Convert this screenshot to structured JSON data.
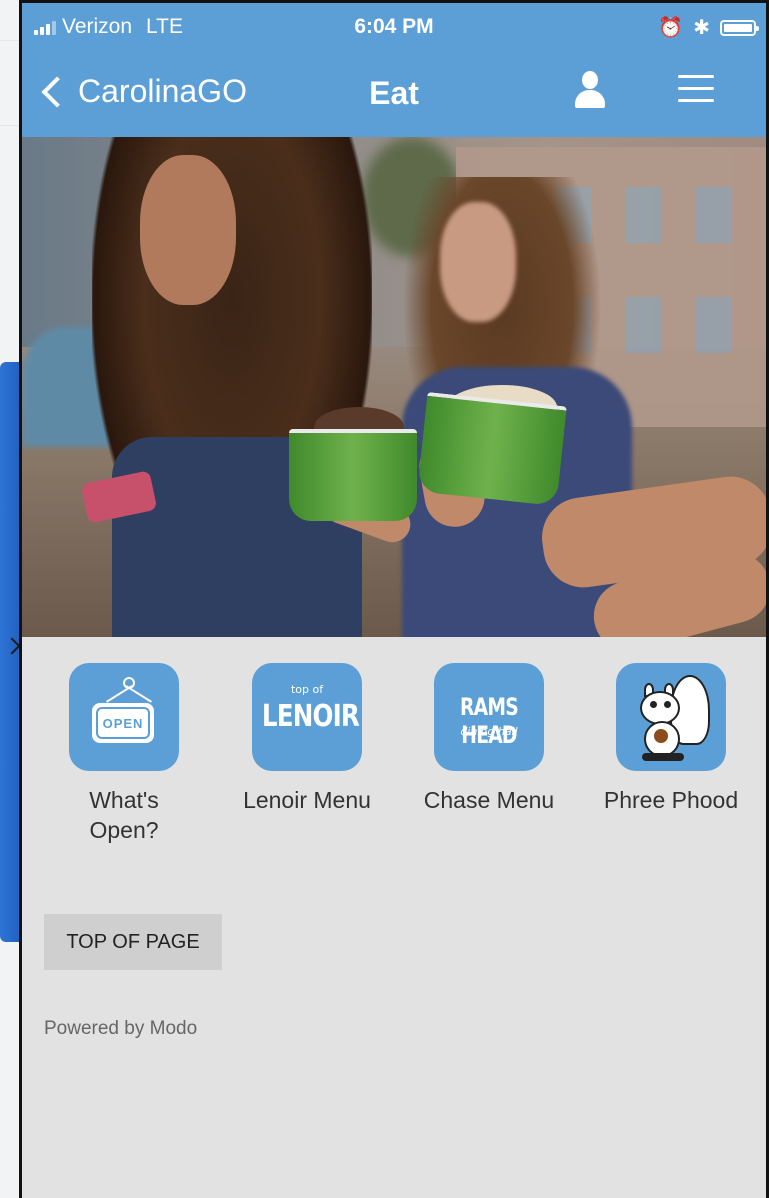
{
  "status_bar": {
    "carrier": "Verizon",
    "network": "LTE",
    "time": "6:04 PM",
    "icons": [
      "signal-icon",
      "alarm-icon",
      "bluetooth-icon",
      "battery-icon"
    ]
  },
  "nav": {
    "back_label": "CarolinaGO",
    "title": "Eat",
    "icons": [
      "chevron-left-icon",
      "user-icon",
      "menu-icon"
    ]
  },
  "hero": {
    "description_icon": "hero-photo"
  },
  "tiles": [
    {
      "label": "What's Open?",
      "icon": "open-sign-icon"
    },
    {
      "label": "Lenoir Menu",
      "icon": "lenoir-logo-icon",
      "logo_top": "top of",
      "logo_main": "LENOIR"
    },
    {
      "label": "Chase Menu",
      "icon": "rams-head-logo-icon",
      "logo_main": "RAMS HEAD",
      "logo_sub": "dining hall"
    },
    {
      "label": "Phree Phood",
      "icon": "squirrel-icon"
    }
  ],
  "open_sign_text": "OPEN",
  "footer": {
    "top_button": "TOP OF PAGE",
    "powered_by": "Powered by Modo"
  },
  "colors": {
    "nav_blue": "#5b9fd6",
    "page_gray": "#e2e2e2",
    "button_gray": "#cfcfcf"
  }
}
